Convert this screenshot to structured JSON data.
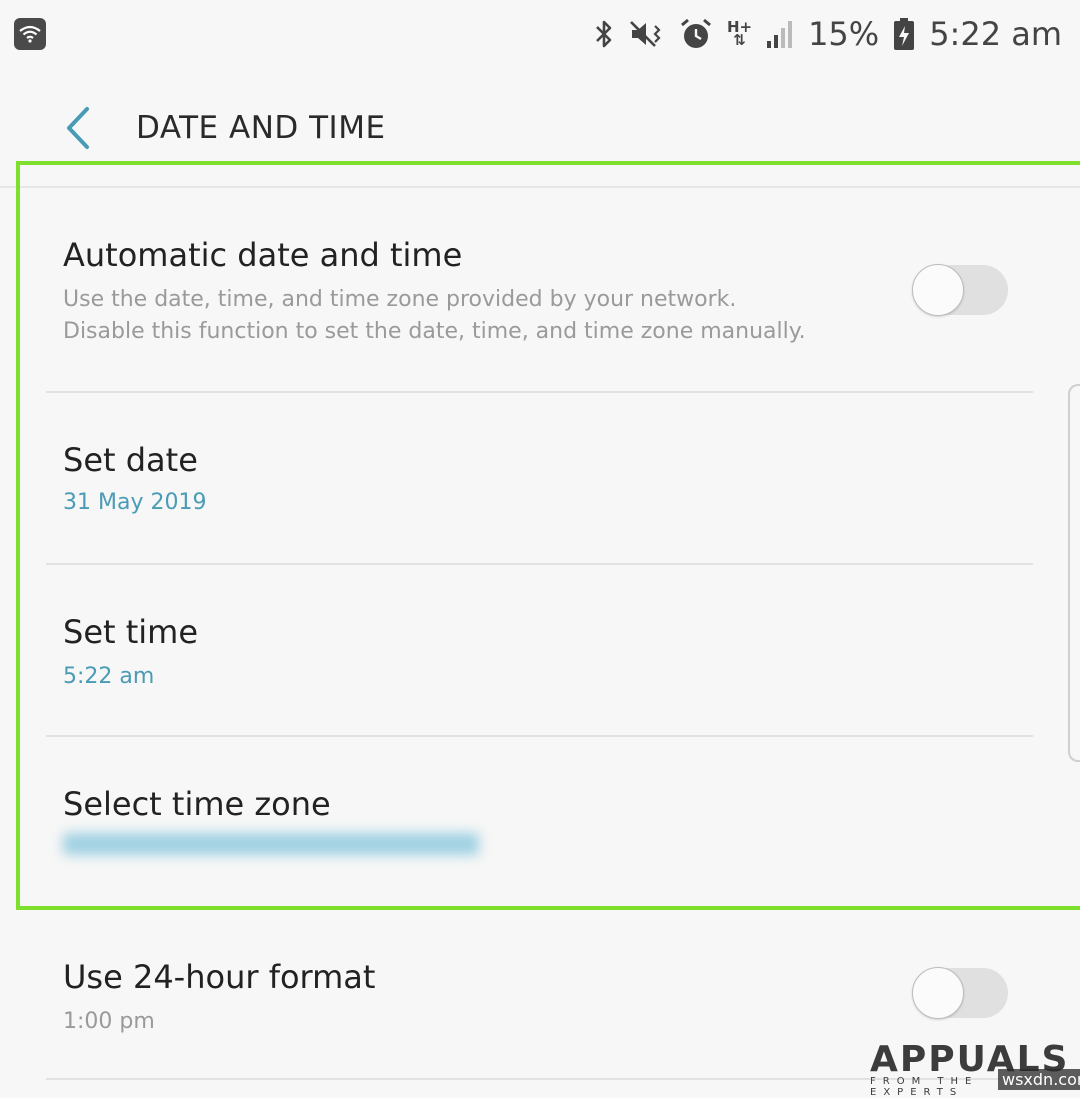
{
  "status_bar": {
    "network_type": "H+",
    "battery_percent": "15%",
    "time": "5:22 am"
  },
  "app_bar": {
    "title": "DATE AND TIME"
  },
  "settings": {
    "auto": {
      "title": "Automatic date and time",
      "desc_line1": "Use the date, time, and time zone provided by your network.",
      "desc_line2": "Disable this function to set the date, time, and time zone manually.",
      "enabled": false
    },
    "set_date": {
      "title": "Set date",
      "value": "31 May 2019"
    },
    "set_time": {
      "title": "Set time",
      "value": "5:22 am"
    },
    "time_zone": {
      "title": "Select time zone"
    },
    "format_24": {
      "title": "Use 24-hour format",
      "value": "1:00 pm",
      "enabled": false
    }
  },
  "watermark": {
    "logo": "APPUALS",
    "tagline": "FROM THE EXPERTS",
    "site": "wsxdn.com"
  },
  "colors": {
    "accent": "#4a9bb5",
    "highlight_border": "#7ee02c"
  }
}
